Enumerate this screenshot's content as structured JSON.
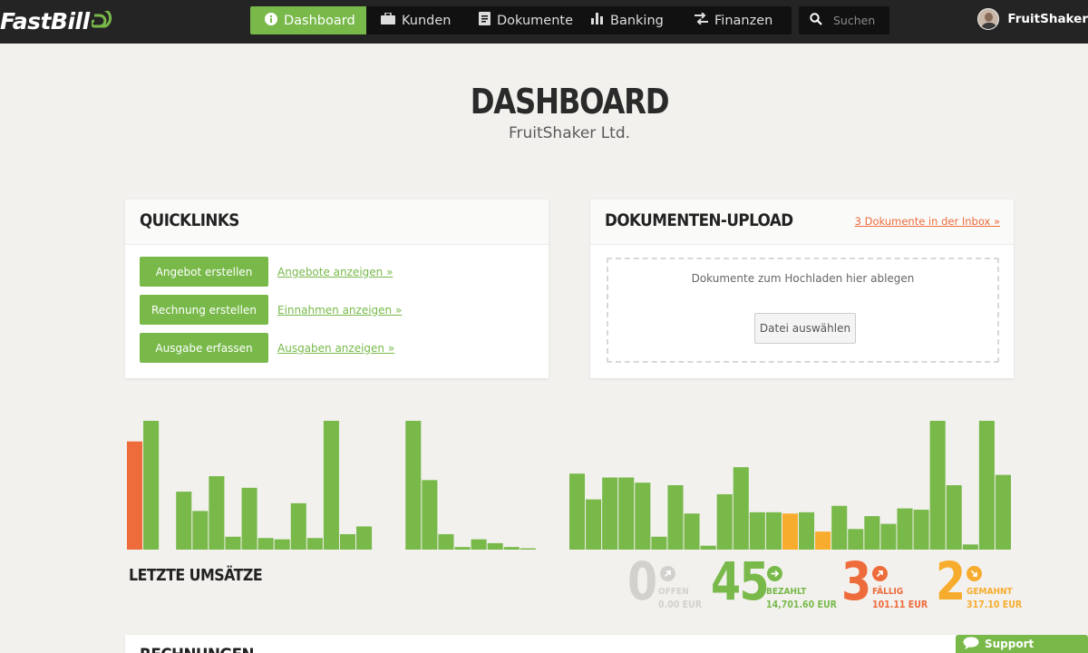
{
  "app": {
    "logo_text": "FastBill"
  },
  "nav": {
    "items": [
      {
        "label": "Dashboard",
        "icon": "info-icon",
        "active": true
      },
      {
        "label": "Kunden",
        "icon": "briefcase-icon",
        "active": false
      },
      {
        "label": "Dokumente",
        "icon": "document-icon",
        "active": false
      },
      {
        "label": "Banking",
        "icon": "bar-chart-icon",
        "active": false
      },
      {
        "label": "Finanzen",
        "icon": "exchange-icon",
        "active": false
      }
    ]
  },
  "search": {
    "placeholder": "Suchen",
    "value": ""
  },
  "user": {
    "name": "FruitShaker"
  },
  "page": {
    "title": "DASHBOARD",
    "subtitle": "FruitShaker Ltd."
  },
  "quicklinks": {
    "title": "QUICKLINKS",
    "rows": [
      {
        "button": "Angebot erstellen",
        "link": "Angebote anzeigen »"
      },
      {
        "button": "Rechnung erstellen",
        "link": "Einnahmen anzeigen »"
      },
      {
        "button": "Ausgabe erfassen",
        "link": "Ausgaben anzeigen »"
      }
    ]
  },
  "upload": {
    "title": "DOKUMENTEN-UPLOAD",
    "inbox_link": "3 Dokumente in der Inbox »",
    "drop_text": "Dokumente zum Hochladen hier ablegen",
    "file_button": "Datei auswählen"
  },
  "revenue": {
    "title": "LETZTE UMSÄTZE",
    "stats": [
      {
        "number": "0",
        "label": "OFFEN",
        "amount": "0.00 EUR",
        "color": "#d3d1cd",
        "icon": "arrow-up-right-icon"
      },
      {
        "number": "45",
        "label": "BEZAHLT",
        "amount": "14,701.60 EUR",
        "color": "#78b94a",
        "icon": "arrow-right-icon"
      },
      {
        "number": "3",
        "label": "FÄLLIG",
        "amount": "101.11 EUR",
        "color": "#ee6b3b",
        "icon": "arrow-up-right-icon"
      },
      {
        "number": "2",
        "label": "GEMAHNT",
        "amount": "317.10 EUR",
        "color": "#f7ac2d",
        "icon": "arrow-down-right-icon"
      }
    ]
  },
  "chart_data": {
    "type": "bar",
    "ylim": [
      0,
      100
    ],
    "grid": false,
    "legend": "none",
    "values": [
      84,
      100,
      0,
      45,
      30,
      57,
      10,
      48,
      9,
      8,
      36,
      9,
      100,
      12,
      18,
      0,
      0,
      100,
      54,
      12,
      2,
      8,
      5,
      2,
      1,
      0,
      0,
      59,
      39,
      56,
      56,
      52,
      10,
      50,
      28,
      3,
      43,
      64,
      29,
      29,
      28,
      29,
      14,
      34,
      16,
      26,
      20,
      32,
      31,
      100,
      50,
      4,
      100,
      58
    ],
    "colors": [
      "o",
      "g",
      "g",
      "g",
      "g",
      "g",
      "g",
      "g",
      "g",
      "g",
      "g",
      "g",
      "g",
      "g",
      "g",
      "g",
      "g",
      "g",
      "g",
      "g",
      "g",
      "g",
      "g",
      "g",
      "g",
      "g",
      "g",
      "g",
      "g",
      "g",
      "g",
      "g",
      "g",
      "g",
      "g",
      "g",
      "g",
      "g",
      "g",
      "g",
      "y",
      "g",
      "y",
      "g",
      "g",
      "g",
      "g",
      "g",
      "g",
      "g",
      "g",
      "g",
      "g",
      "g"
    ],
    "palette": {
      "g": "#78b94a",
      "o": "#ee6b3b",
      "y": "#f7ac2d"
    }
  },
  "rechnungen": {
    "title": "RECHNUNGEN"
  },
  "support": {
    "label": "Support"
  },
  "colors": {
    "accent": "#78b94a",
    "orange": "#ee6b3b",
    "yellow": "#f7ac2d",
    "topbar": "#242424",
    "background": "#f3f1ee"
  }
}
